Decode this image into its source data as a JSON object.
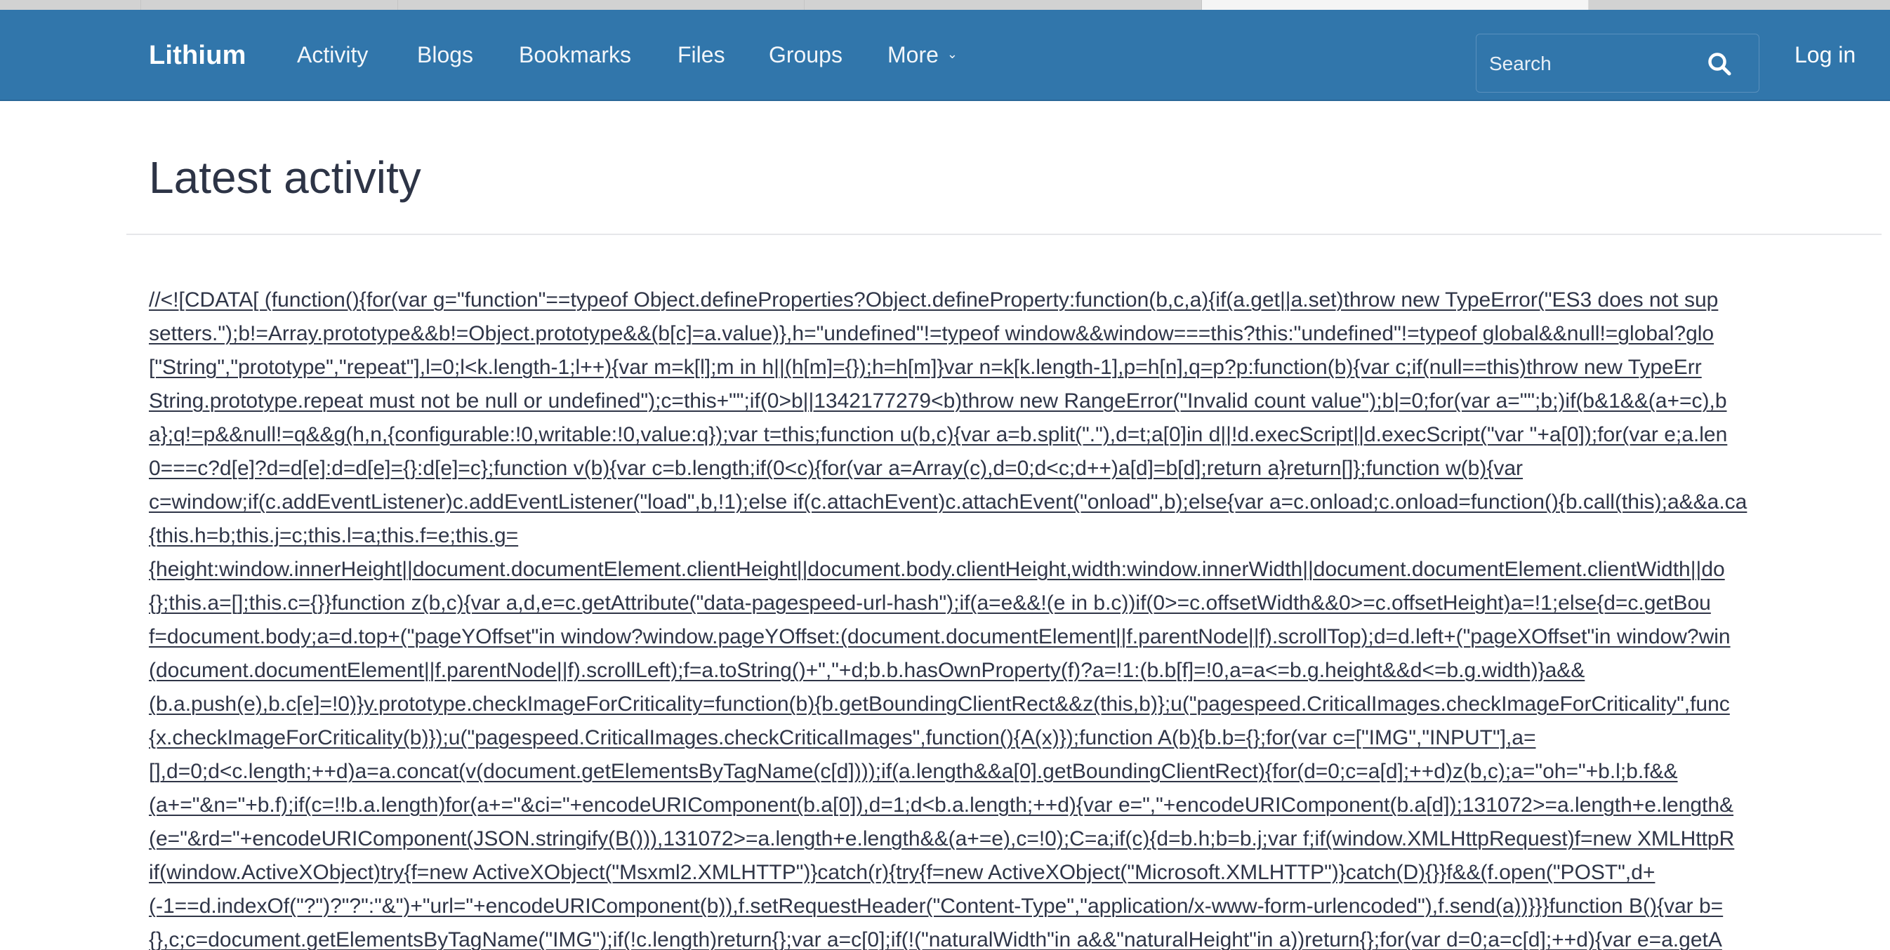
{
  "navbar": {
    "brand": "Lithium",
    "items": [
      {
        "label": "Activity"
      },
      {
        "label": "Blogs"
      },
      {
        "label": "Bookmarks"
      },
      {
        "label": "Files"
      },
      {
        "label": "Groups"
      },
      {
        "label": "More"
      }
    ],
    "more_caret": "⌄",
    "search": {
      "placeholder": "Search"
    },
    "login_label": "Log in",
    "color": "#3176ab"
  },
  "main": {
    "title": "Latest activity",
    "code_lines": [
      "//<![CDATA[ (function(){for(var g=\"function\"==typeof Object.defineProperties?Object.defineProperty:function(b,c,a){if(a.get||a.set)throw new TypeError(\"ES3 does not sup",
      "setters.\");b!=Array.prototype&&b!=Object.prototype&&(b[c]=a.value)},h=\"undefined\"!=typeof window&&window===this?this:\"undefined\"!=typeof global&&null!=global?glo",
      "[\"String\",\"prototype\",\"repeat\"],l=0;l<k.length-1;l++){var m=k[l];m in h||(h[m]={});h=h[m]}var n=k[k.length-1],p=h[n],q=p?p:function(b){var c;if(null==this)throw new TypeErr",
      "String.prototype.repeat must not be null or undefined\");c=this+\"\";if(0>b||1342177279<b)throw new RangeError(\"Invalid count value\");b|=0;for(var a=\"\";b;)if(b&1&&(a+=c),b",
      "a};q!=p&&null!=q&&g(h,n,{configurable:!0,writable:!0,value:q});var t=this;function u(b,c){var a=b.split(\".\"),d=t;a[0]in d||!d.execScript||d.execScript(\"var \"+a[0]);for(var e;a.len",
      "0===c?d[e]?d=d[e]:d=d[e]={}:d[e]=c};function v(b){var c=b.length;if(0<c){for(var a=Array(c),d=0;d<c;d++)a[d]=b[d];return a}return[]};function w(b){var",
      "c=window;if(c.addEventListener)c.addEventListener(\"load\",b,!1);else if(c.attachEvent)c.attachEvent(\"onload\",b);else{var a=c.onload;c.onload=function(){b.call(this);a&&a.ca",
      "{this.h=b;this.j=c;this.l=a;this.f=e;this.g=",
      "{height:window.innerHeight||document.documentElement.clientHeight||document.body.clientHeight,width:window.innerWidth||document.documentElement.clientWidth||do",
      "{};this.a=[];this.c={}}function z(b,c){var a,d,e=c.getAttribute(\"data-pagespeed-url-hash\");if(a=e&&!(e in b.c))if(0>=c.offsetWidth&&0>=c.offsetHeight)a=!1;else{d=c.getBou",
      "f=document.body;a=d.top+(\"pageYOffset\"in window?window.pageYOffset:(document.documentElement||f.parentNode||f).scrollTop);d=d.left+(\"pageXOffset\"in window?win",
      "(document.documentElement||f.parentNode||f).scrollLeft);f=a.toString()+\",\"+d;b.b.hasOwnProperty(f)?a=!1:(b.b[f]=!0,a=a<=b.g.height&&d<=b.g.width)}a&&",
      "(b.a.push(e),b.c[e]=!0)}y.prototype.checkImageForCriticality=function(b){b.getBoundingClientRect&&z(this,b)};u(\"pagespeed.CriticalImages.checkImageForCriticality\",func",
      "{x.checkImageForCriticality(b)});u(\"pagespeed.CriticalImages.checkCriticalImages\",function(){A(x)});function A(b){b.b={};for(var c=[\"IMG\",\"INPUT\"],a=",
      "[],d=0;d<c.length;++d)a=a.concat(v(document.getElementsByTagName(c[d])));if(a.length&&a[0].getBoundingClientRect){for(d=0;c=a[d];++d)z(b,c);a=\"oh=\"+b.l;b.f&&",
      "(a+=\"&n=\"+b.f);if(c=!!b.a.length)for(a+=\"&ci=\"+encodeURIComponent(b.a[0]),d=1;d<b.a.length;++d){var e=\",\"+encodeURIComponent(b.a[d]);131072>=a.length+e.length&",
      "(e=\"&rd=\"+encodeURIComponent(JSON.stringify(B())),131072>=a.length+e.length&&(a+=e),c=!0);C=a;if(c){d=b.h;b=b.j;var f;if(window.XMLHttpRequest)f=new XMLHttpR",
      "if(window.ActiveXObject)try{f=new ActiveXObject(\"Msxml2.XMLHTTP\")}catch(r){try{f=new ActiveXObject(\"Microsoft.XMLHTTP\")}catch(D){}}f&&(f.open(\"POST\",d+",
      "(-1==d.indexOf(\"?\")?\"?\":\"&\")+\"url=\"+encodeURIComponent(b)),f.setRequestHeader(\"Content-Type\",\"application/x-www-form-urlencoded\"),f.send(a))}}}function B(){var b=",
      "{},c;c=document.getElementsByTagName(\"IMG\");if(!c.length)return{};var a=c[0];if(!(\"naturalWidth\"in a&&\"naturalHeight\"in a))return{};for(var d=0;a=c[d];++d){var e=a.getA"
    ]
  }
}
